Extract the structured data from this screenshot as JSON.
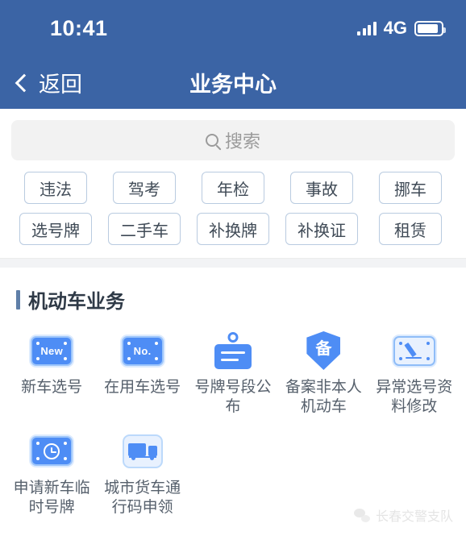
{
  "status_bar": {
    "time": "10:41",
    "network": "4G",
    "signal_icon": "signal-bars-icon",
    "battery_icon": "battery-icon"
  },
  "navbar": {
    "back_icon": "chevron-left-icon",
    "back_label": "返回",
    "title": "业务中心"
  },
  "search": {
    "icon": "search-icon",
    "placeholder": "搜索",
    "value": ""
  },
  "chips": {
    "row1": [
      {
        "label": "违法"
      },
      {
        "label": "驾考"
      },
      {
        "label": "年检"
      },
      {
        "label": "事故"
      },
      {
        "label": "挪车"
      }
    ],
    "row2": [
      {
        "label": "选号牌"
      },
      {
        "label": "二手车"
      },
      {
        "label": "补换牌"
      },
      {
        "label": "补换证"
      },
      {
        "label": "租赁"
      }
    ]
  },
  "section": {
    "title": "机动车业务",
    "items": [
      {
        "label": "新车选号",
        "icon": "new-plate-icon",
        "glyph": "New"
      },
      {
        "label": "在用车选号",
        "icon": "no-plate-icon",
        "glyph": "No."
      },
      {
        "label": "号牌号段公布",
        "icon": "hanging-sign-icon",
        "glyph": ""
      },
      {
        "label": "备案非本人机动车",
        "icon": "shield-record-icon",
        "glyph": "备"
      },
      {
        "label": "异常选号资料修改",
        "icon": "edit-plate-icon",
        "glyph": ""
      },
      {
        "label": "申请新车临时号牌",
        "icon": "temp-plate-clock-icon",
        "glyph": ""
      },
      {
        "label": "城市货车通行码申领",
        "icon": "truck-icon",
        "glyph": ""
      }
    ]
  },
  "watermark": {
    "logo_icon": "wechat-logo-icon",
    "text": "长春交警支队"
  },
  "colors": {
    "header_blue": "#3b64a5",
    "icon_blue": "#4e8df5",
    "chip_border": "#b9cbe0",
    "section_accent": "#5f7fa8"
  }
}
